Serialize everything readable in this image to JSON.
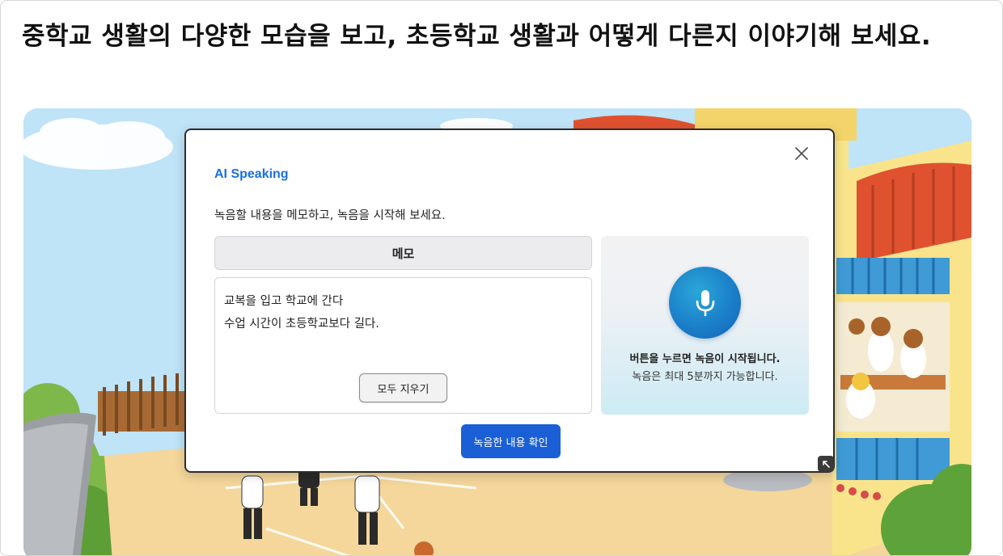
{
  "question": {
    "text": "중학교 생활의 다양한 모습을 보고, 초등학교 생활과 어떻게 다른지 이야기해 보세요."
  },
  "modal": {
    "title": "AI Speaking",
    "instruction": "녹음할 내용을 메모하고, 녹음을 시작해 보세요.",
    "memo_header": "메모",
    "memo_lines": [
      "교복을 입고 학교에 간다",
      "수업 시간이 초등학교보다 길다."
    ],
    "clear_button": "모두 지우기",
    "record_hint_primary": "버튼을 누르면 녹음이 시작됩니다.",
    "record_hint_secondary": "녹음은 최대 5분까지 가능합니다.",
    "confirm_button": "녹음한 내용 확인",
    "icons": {
      "close": "close-icon",
      "mic": "microphone-icon",
      "expand": "expand-icon"
    },
    "colors": {
      "title": "#1b6fe0",
      "confirm_button": "#1a5fd6",
      "mic_button": "#1b7fc9"
    }
  }
}
